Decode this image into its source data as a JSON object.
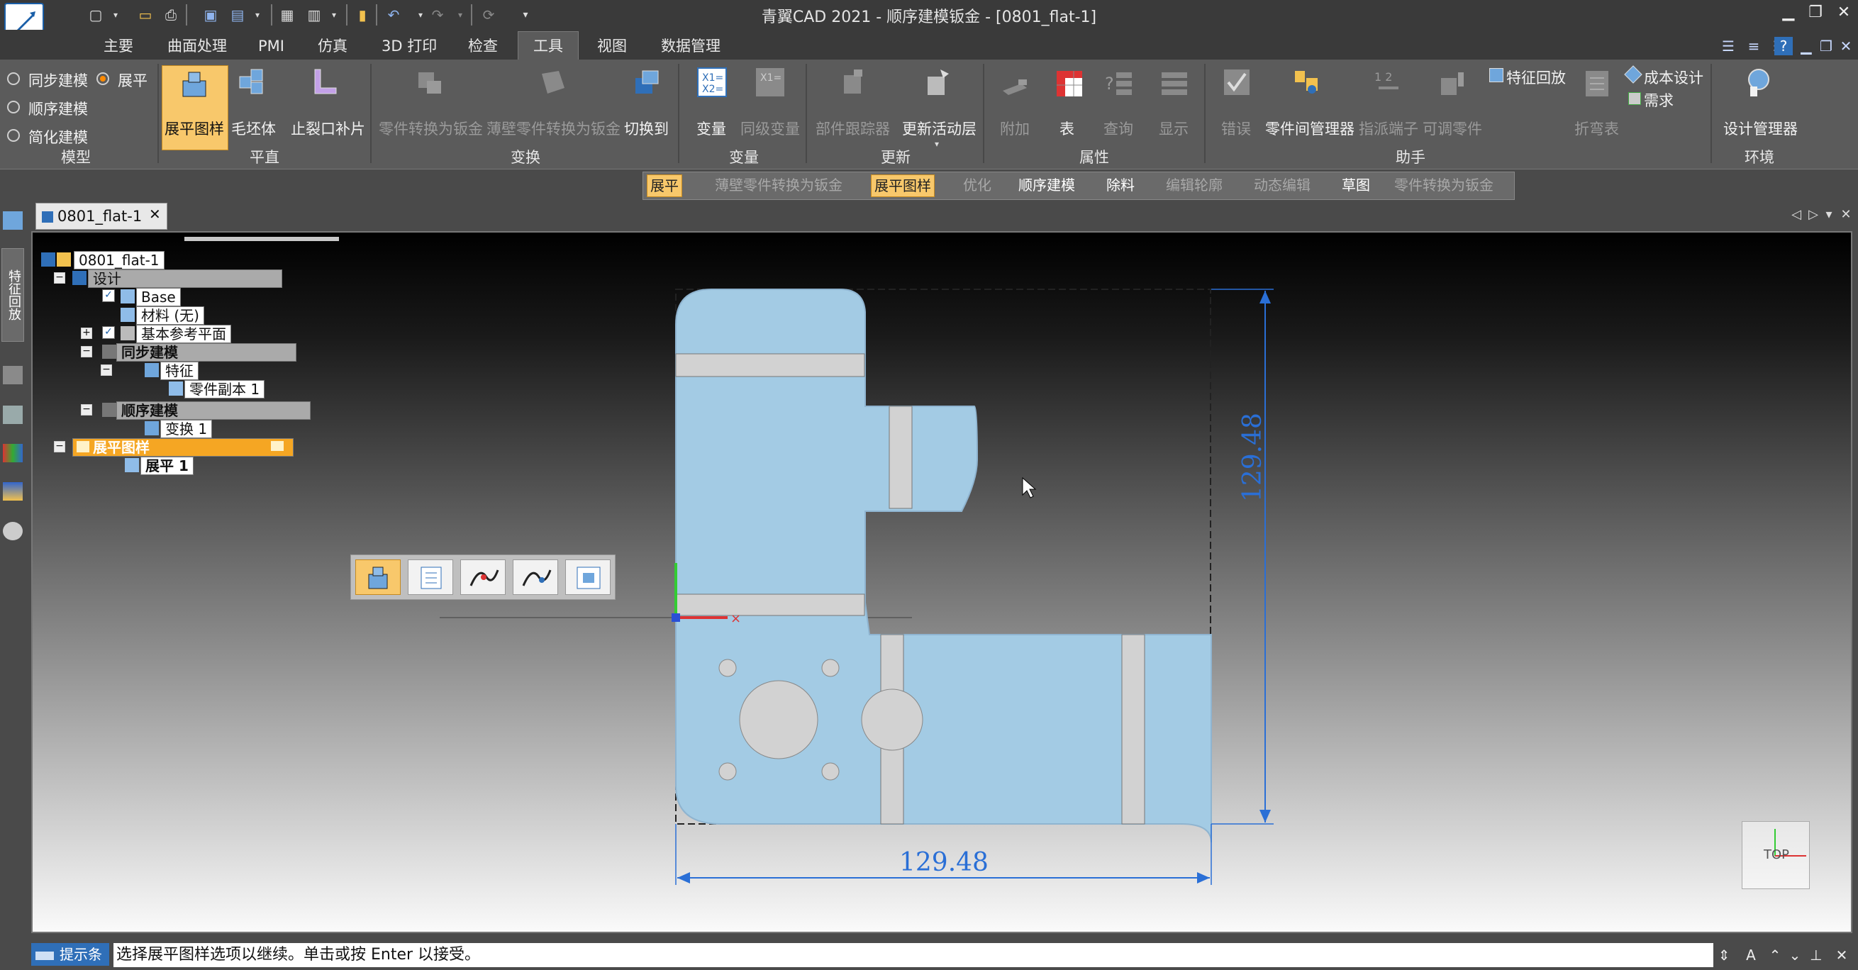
{
  "window": {
    "title": "青翼CAD 2021 - 顺序建模钣金 - [0801_flat-1]",
    "minimize": "▁",
    "restore": "❐",
    "close": "✕"
  },
  "quick_access": [
    "new-icon",
    "open-icon",
    "save-icon",
    "undo-icon",
    "redo-icon"
  ],
  "ribbon_tabs": [
    {
      "label": "主要"
    },
    {
      "label": "曲面处理"
    },
    {
      "label": "PMI"
    },
    {
      "label": "仿真"
    },
    {
      "label": "3D 打印"
    },
    {
      "label": "检查"
    },
    {
      "label": "工具"
    },
    {
      "label": "视图"
    },
    {
      "label": "数据管理"
    }
  ],
  "active_tab": "工具",
  "ribbon": {
    "model_group": {
      "options": [
        {
          "label": "同步建模",
          "selected": false
        },
        {
          "label": "展平",
          "selected": true
        },
        {
          "label": "顺序建模",
          "selected": false
        },
        {
          "label": "简化建模",
          "selected": false
        }
      ],
      "label": "模型"
    },
    "flat_group": {
      "buttons": [
        {
          "label": "展平图样"
        },
        {
          "label": "毛坯体"
        },
        {
          "label": "止裂口补片"
        }
      ],
      "label": "平直"
    },
    "transform_group": {
      "buttons": [
        {
          "label": "零件转换为钣金",
          "disabled": true
        },
        {
          "label": "薄壁零件转换为钣金",
          "disabled": true
        },
        {
          "label": "切换到",
          "disabled": false
        }
      ],
      "label": "变换"
    },
    "variable_group": {
      "buttons": [
        {
          "label": "变量",
          "disabled": false
        },
        {
          "label": "同级变量",
          "disabled": true
        }
      ],
      "label": "变量"
    },
    "update_group": {
      "buttons": [
        {
          "label": "部件跟踪器",
          "disabled": true
        },
        {
          "label": "更新活动层",
          "disabled": false
        }
      ],
      "label": "更新"
    },
    "property_group": {
      "buttons": [
        {
          "label": "附加",
          "disabled": true
        },
        {
          "label": "表",
          "disabled": false
        },
        {
          "label": "查询",
          "disabled": true
        },
        {
          "label": "显示",
          "disabled": true
        }
      ],
      "label": "属性"
    },
    "assistant_group": {
      "buttons": [
        {
          "label": "错误",
          "disabled": true
        },
        {
          "label": "零件间管理器",
          "disabled": false
        },
        {
          "label": "指派端子",
          "disabled": true
        },
        {
          "label": "可调零件",
          "disabled": true
        },
        {
          "label": "特征回放",
          "disabled": false
        },
        {
          "label": "折弯表",
          "disabled": true
        },
        {
          "label": "成本设计",
          "disabled": false
        },
        {
          "label": "需求",
          "disabled": false
        }
      ],
      "label": "助手"
    },
    "env_group": {
      "buttons": [
        {
          "label": "设计管理器"
        }
      ],
      "label": "环境"
    }
  },
  "command_bar": [
    {
      "label": "展平",
      "state": "hl"
    },
    {
      "label": "薄壁零件转换为钣金",
      "state": "dis"
    },
    {
      "label": "展平图样",
      "state": "hl"
    },
    {
      "label": "优化",
      "state": "dis"
    },
    {
      "label": "顺序建模",
      "state": "on"
    },
    {
      "label": "除料",
      "state": "on"
    },
    {
      "label": "编辑轮廓",
      "state": "dis"
    },
    {
      "label": "动态编辑",
      "state": "dis"
    },
    {
      "label": "草图",
      "state": "on"
    },
    {
      "label": "零件转换为钣金",
      "state": "dis"
    }
  ],
  "side_strip": {
    "tab_label": "特征回放"
  },
  "document_tab": {
    "label": "0801_flat-1",
    "close": "✕"
  },
  "tree": {
    "root": "0801_flat-1",
    "design": "设计",
    "base": "Base",
    "material": "材料 (无)",
    "ref_planes": "基本参考平面",
    "sync": "同步建模",
    "features": "特征",
    "part_copy": "零件副本 1",
    "ordered": "顺序建模",
    "transform": "变换 1",
    "flat_pattern": "展平图样",
    "flat1": "展平 1"
  },
  "drawing": {
    "dim_vertical": "129.48",
    "dim_horizontal": "129.48",
    "part_fill": "#a3cbe4",
    "bend_fill": "#d2d2d2",
    "dim_color": "#2a6fd6"
  },
  "view_cube": {
    "label": "TOP"
  },
  "status": {
    "prompt_label": "提示条",
    "prompt_text": "选择展平图样选项以继续。单击或按 Enter 以接受。"
  }
}
